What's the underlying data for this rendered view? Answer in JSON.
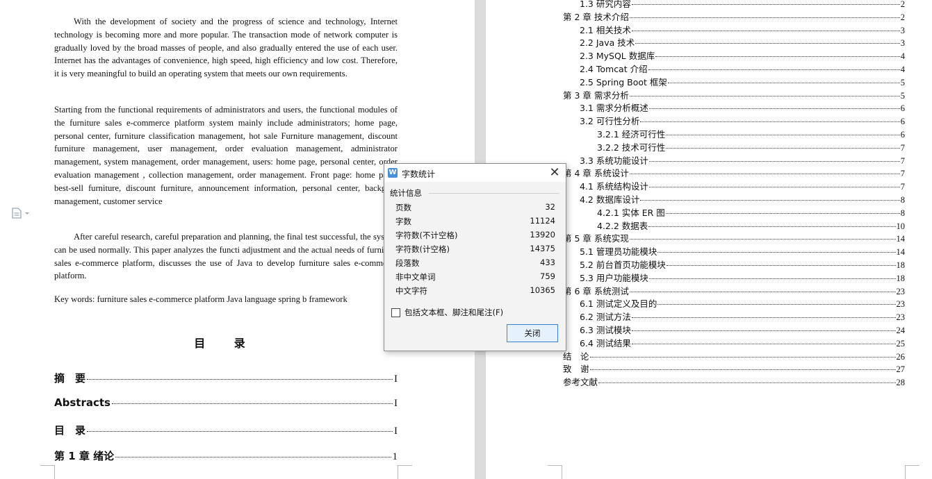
{
  "left_page": {
    "paragraphs": [
      "With the development of society and the progress of science and technology, Internet technology is becoming more and more popular. The transaction mode of network computer is gradually loved by the broad masses of people, and also gradually entered the use of each user. Internet has the advantages of convenience, high speed, high efficiency and low cost. Therefore, it is very meaningful to build an operating system that meets our own requirements.",
      "Starting from the functional requirements of administrators and users, the functional modules of the furniture sales e-commerce platform system mainly include administrators; home page, personal center, furniture classification management, hot sale Furniture management, discount furniture management, user management, order evaluation management, administrator management, system management, order management, users: home page, personal center, order evaluation management , collection management, order management. Front page: home page, best-sell furniture, discount furniture, announcement information, personal center, backgrou management, customer service",
      "After careful research, careful preparation and planning, the final test successful, the system can be used normally. This paper analyzes the functi adjustment and the actual needs of furniture sales e-commerce platform, discusses the use of Java to develop furniture sales e-commerce platform.",
      "Key words: furniture sales e-commerce platform Java language spring b framework"
    ],
    "toc_title": "目 录",
    "toc_entries": [
      {
        "title": "摘　要",
        "page": "I"
      },
      {
        "title": "Abstracts",
        "page": "I"
      },
      {
        "title": "目　录",
        "page": "I"
      },
      {
        "title": "第 1 章  绪论",
        "page": "1"
      }
    ]
  },
  "right_page": {
    "toc_entries": [
      {
        "title": "1.3 研究内容",
        "page": "2",
        "level": 1
      },
      {
        "title": "第 2 章  技术介绍",
        "page": "2",
        "level": 0
      },
      {
        "title": "2.1 相关技术",
        "page": "3",
        "level": 1
      },
      {
        "title": "2.2  Java 技术",
        "page": "3",
        "level": 1
      },
      {
        "title": "2.3  MySQL 数据库",
        "page": "4",
        "level": 1
      },
      {
        "title": "2.4  Tomcat 介绍",
        "page": "4",
        "level": 1
      },
      {
        "title": "2.5  Spring   Boot 框架",
        "page": "5",
        "level": 1
      },
      {
        "title": "第 3 章  需求分析",
        "page": "5",
        "level": 0
      },
      {
        "title": "3.1 需求分析概述",
        "page": "6",
        "level": 1
      },
      {
        "title": "3.2 可行性分析",
        "page": "6",
        "level": 1
      },
      {
        "title": "3.2.1 经济可行性",
        "page": "6",
        "level": 2
      },
      {
        "title": "3.2.2 技术可行性",
        "page": "7",
        "level": 2
      },
      {
        "title": "3.3 系统功能设计",
        "page": "7",
        "level": 1
      },
      {
        "title": "第 4 章  系统设计",
        "page": "7",
        "level": 0
      },
      {
        "title": "4.1 系统结构设计",
        "page": "7",
        "level": 1
      },
      {
        "title": "4.2 数据库设计",
        "page": "8",
        "level": 1
      },
      {
        "title": "4.2.1 实体 ER 图",
        "page": "8",
        "level": 2
      },
      {
        "title": "4.2.2 数据表",
        "page": "10",
        "level": 2
      },
      {
        "title": "第 5 章  系统实现",
        "page": "14",
        "level": 0
      },
      {
        "title": "5.1 管理员功能模块",
        "page": "14",
        "level": 1
      },
      {
        "title": "5.2 前台首页功能模块",
        "page": "18",
        "level": 1
      },
      {
        "title": "5.3 用户功能模块",
        "page": "18",
        "level": 1
      },
      {
        "title": "第 6 章  系统测试",
        "page": "23",
        "level": 0
      },
      {
        "title": "6.1 测试定义及目的",
        "page": "23",
        "level": 1
      },
      {
        "title": "6.2 测试方法",
        "page": "23",
        "level": 1
      },
      {
        "title": "6.3 测试模块",
        "page": "24",
        "level": 1
      },
      {
        "title": "6.4 测试结果",
        "page": "25",
        "level": 1
      },
      {
        "title": "结　论",
        "page": "26",
        "level": 0
      },
      {
        "title": "致　谢",
        "page": "27",
        "level": 0
      },
      {
        "title": "参考文献",
        "page": "28",
        "level": 0
      }
    ]
  },
  "dialog": {
    "icon_letter": "W",
    "title": "字数统计",
    "section_label": "统计信息",
    "stats": [
      {
        "label": "页数",
        "value": "32"
      },
      {
        "label": "字数",
        "value": "11124"
      },
      {
        "label": "字符数(不计空格)",
        "value": "13920"
      },
      {
        "label": "字符数(计空格)",
        "value": "14375"
      },
      {
        "label": "段落数",
        "value": "433"
      },
      {
        "label": "非中文单词",
        "value": "759"
      },
      {
        "label": "中文字符",
        "value": "10365"
      }
    ],
    "checkbox_label": "包括文本框、脚注和尾注(F)",
    "close_label": "关闭"
  },
  "colors": {
    "accent": "#3b7fd6",
    "app_icon": "#4a90d9"
  }
}
